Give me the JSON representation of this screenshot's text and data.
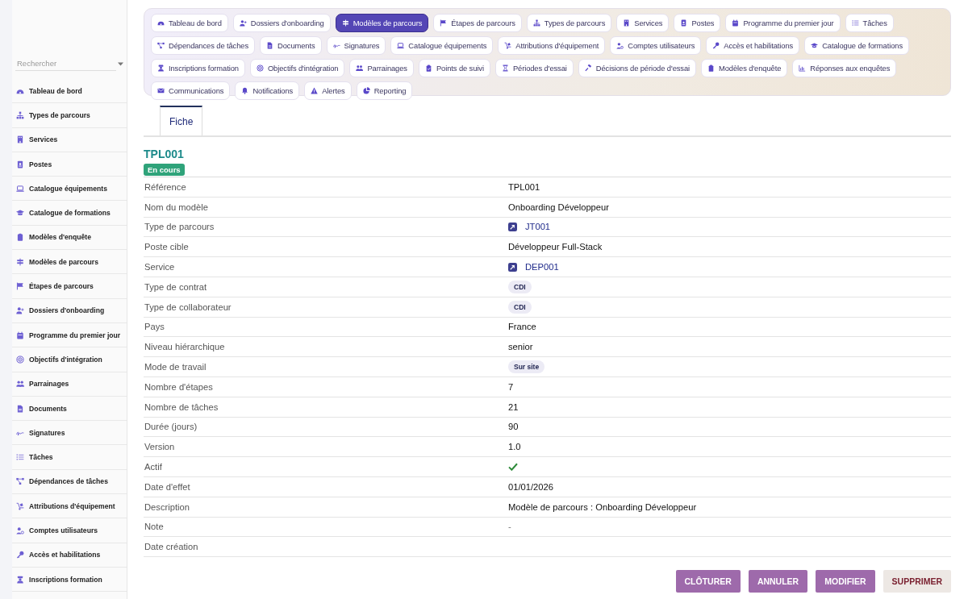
{
  "sidebar": {
    "search": {
      "placeholder": "Rechercher"
    },
    "items": [
      {
        "label": "Tableau de bord"
      },
      {
        "label": "Types de parcours"
      },
      {
        "label": "Services"
      },
      {
        "label": "Postes"
      },
      {
        "label": "Catalogue équipements"
      },
      {
        "label": "Catalogue de formations"
      },
      {
        "label": "Modèles d'enquête"
      },
      {
        "label": "Modèles de parcours"
      },
      {
        "label": "Étapes de parcours"
      },
      {
        "label": "Dossiers d'onboarding"
      },
      {
        "label": "Programme du premier jour"
      },
      {
        "label": "Objectifs d'intégration"
      },
      {
        "label": "Parrainages"
      },
      {
        "label": "Documents"
      },
      {
        "label": "Signatures"
      },
      {
        "label": "Tâches"
      },
      {
        "label": "Dépendances de tâches"
      },
      {
        "label": "Attributions d'équipement"
      },
      {
        "label": "Comptes utilisateurs"
      },
      {
        "label": "Accès et habilitations"
      },
      {
        "label": "Inscriptions formation"
      }
    ]
  },
  "nav": [
    {
      "label": "Tableau de bord",
      "selected": false
    },
    {
      "label": "Dossiers d'onboarding",
      "selected": false
    },
    {
      "label": "Modèles de parcours",
      "selected": true
    },
    {
      "label": "Étapes de parcours",
      "selected": false
    },
    {
      "label": "Types de parcours",
      "selected": false
    },
    {
      "label": "Services",
      "selected": false
    },
    {
      "label": "Postes",
      "selected": false
    },
    {
      "label": "Programme du premier jour",
      "selected": false
    },
    {
      "label": "Tâches",
      "selected": false
    },
    {
      "label": "Dépendances de tâches",
      "selected": false
    },
    {
      "label": "Documents",
      "selected": false
    },
    {
      "label": "Signatures",
      "selected": false
    },
    {
      "label": "Catalogue équipements",
      "selected": false
    },
    {
      "label": "Attributions d'équipement",
      "selected": false
    },
    {
      "label": "Comptes utilisateurs",
      "selected": false
    },
    {
      "label": "Accès et habilitations",
      "selected": false
    },
    {
      "label": "Catalogue de formations",
      "selected": false
    },
    {
      "label": "Inscriptions formation",
      "selected": false
    },
    {
      "label": "Objectifs d'intégration",
      "selected": false
    },
    {
      "label": "Parrainages",
      "selected": false
    },
    {
      "label": "Points de suivi",
      "selected": false
    },
    {
      "label": "Périodes d'essai",
      "selected": false
    },
    {
      "label": "Décisions de période d'essai",
      "selected": false
    },
    {
      "label": "Modèles d'enquête",
      "selected": false
    },
    {
      "label": "Réponses aux enquêtes",
      "selected": false
    },
    {
      "label": "Communications",
      "selected": false
    },
    {
      "label": "Notifications",
      "selected": false
    },
    {
      "label": "Alertes",
      "selected": false
    },
    {
      "label": "Reporting",
      "selected": false
    }
  ],
  "tabs": [
    {
      "label": "Fiche",
      "selected": true
    }
  ],
  "record": {
    "title": "TPL001",
    "status": "En cours"
  },
  "fields": [
    {
      "label": "Référence",
      "kind": "text",
      "value": "TPL001"
    },
    {
      "label": "Nom du modèle",
      "kind": "text",
      "value": "Onboarding Développeur"
    },
    {
      "label": "Type de parcours",
      "kind": "link",
      "value": "JT001"
    },
    {
      "label": "Poste cible",
      "kind": "text",
      "value": "Développeur Full-Stack"
    },
    {
      "label": "Service",
      "kind": "link",
      "value": "DEP001"
    },
    {
      "label": "Type de contrat",
      "kind": "tag",
      "value": "CDI"
    },
    {
      "label": "Type de collaborateur",
      "kind": "tag",
      "value": "CDI"
    },
    {
      "label": "Pays",
      "kind": "text",
      "value": "France"
    },
    {
      "label": "Niveau hiérarchique",
      "kind": "text",
      "value": "senior"
    },
    {
      "label": "Mode de travail",
      "kind": "tag",
      "value": "Sur site"
    },
    {
      "label": "Nombre d'étapes",
      "kind": "text",
      "value": "7"
    },
    {
      "label": "Nombre de tâches",
      "kind": "text",
      "value": "21"
    },
    {
      "label": "Durée (jours)",
      "kind": "text",
      "value": "90"
    },
    {
      "label": "Version",
      "kind": "text",
      "value": "1.0"
    },
    {
      "label": "Actif",
      "kind": "bool",
      "checked": true
    },
    {
      "label": "Date d'effet",
      "kind": "text",
      "value": "01/01/2026"
    },
    {
      "label": "Description",
      "kind": "text",
      "value": "Modèle de parcours : Onboarding Développeur"
    },
    {
      "label": "Note",
      "kind": "empty",
      "value": "-"
    },
    {
      "label": "Date création",
      "kind": "text"
    }
  ],
  "actions": [
    {
      "label": "CLÔTURER",
      "kind": "primary"
    },
    {
      "label": "ANNULER",
      "kind": "primary"
    },
    {
      "label": "MODIFIER",
      "kind": "primary"
    },
    {
      "label": "SUPPRIMER",
      "kind": "danger"
    }
  ]
}
